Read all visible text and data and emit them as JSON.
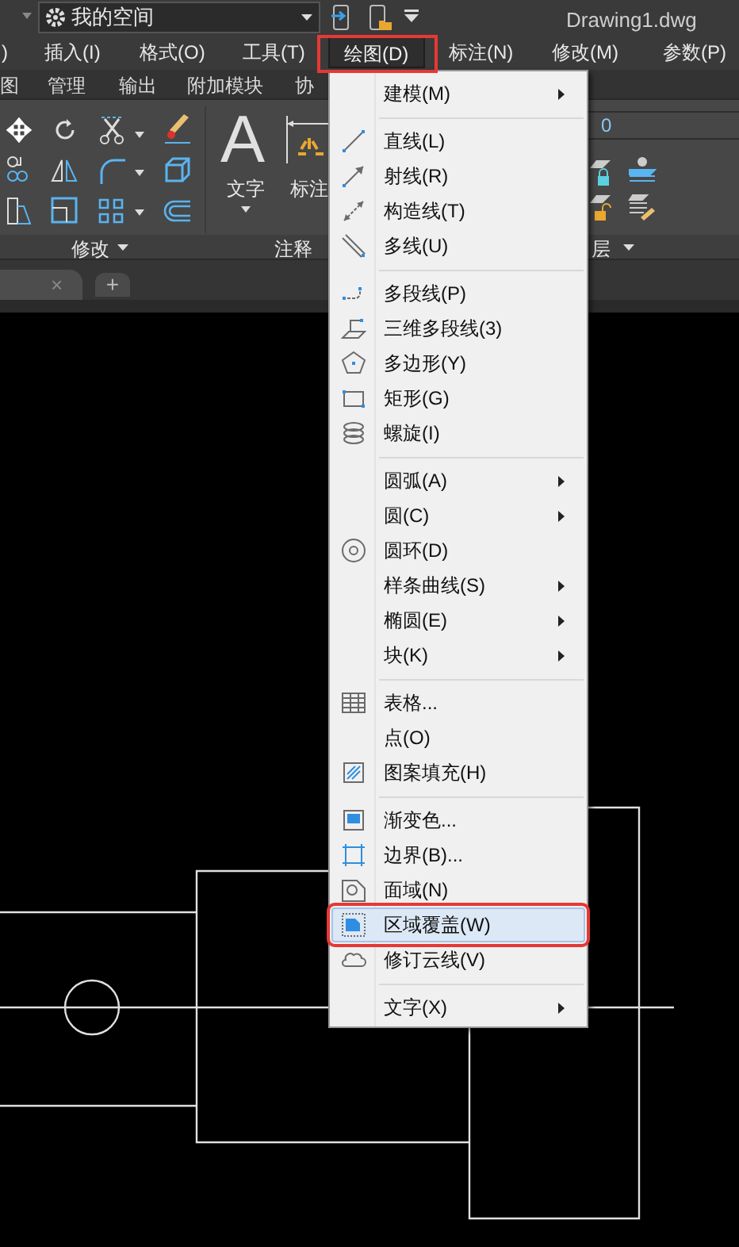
{
  "title_bar": {
    "workspace": "我的空间",
    "file_name": "Drawing1.dwg"
  },
  "menu_bar": [
    {
      "label": ")",
      "selected": false,
      "annotated": false
    },
    {
      "label": "插入(I)",
      "selected": false,
      "annotated": false
    },
    {
      "label": "格式(O)",
      "selected": false,
      "annotated": false
    },
    {
      "label": "工具(T)",
      "selected": false,
      "annotated": false
    },
    {
      "label": "绘图(D)",
      "selected": true,
      "annotated": true
    },
    {
      "label": "标注(N)",
      "selected": false,
      "annotated": false
    },
    {
      "label": "修改(M)",
      "selected": false,
      "annotated": false
    },
    {
      "label": "参数(P)",
      "selected": false,
      "annotated": false
    }
  ],
  "ribbon_tabs": [
    "图",
    "管理",
    "输出",
    "附加模块",
    "协"
  ],
  "ribbon": {
    "modify_title": "修改",
    "annotate_title": "注释",
    "text_glyph": "A",
    "text_label": "文字",
    "dimension_label": "标注",
    "layer_title": "层",
    "layer_value": "0"
  },
  "file_tabs": {
    "close_glyph": "×",
    "new_tab_glyph": "+"
  },
  "draw_menu": [
    {
      "kind": "item",
      "label": "建模(M)",
      "submenu": true,
      "selected": false,
      "annotated": false
    },
    {
      "kind": "separator"
    },
    {
      "kind": "item",
      "label": "直线(L)",
      "submenu": false,
      "selected": false,
      "annotated": false
    },
    {
      "kind": "item",
      "label": "射线(R)",
      "submenu": false,
      "selected": false,
      "annotated": false
    },
    {
      "kind": "item",
      "label": "构造线(T)",
      "submenu": false,
      "selected": false,
      "annotated": false
    },
    {
      "kind": "item",
      "label": "多线(U)",
      "submenu": false,
      "selected": false,
      "annotated": false
    },
    {
      "kind": "separator"
    },
    {
      "kind": "item",
      "label": "多段线(P)",
      "submenu": false,
      "selected": false,
      "annotated": false
    },
    {
      "kind": "item",
      "label": "三维多段线(3)",
      "submenu": false,
      "selected": false,
      "annotated": false
    },
    {
      "kind": "item",
      "label": "多边形(Y)",
      "submenu": false,
      "selected": false,
      "annotated": false
    },
    {
      "kind": "item",
      "label": "矩形(G)",
      "submenu": false,
      "selected": false,
      "annotated": false
    },
    {
      "kind": "item",
      "label": "螺旋(I)",
      "submenu": false,
      "selected": false,
      "annotated": false
    },
    {
      "kind": "separator"
    },
    {
      "kind": "item",
      "label": "圆弧(A)",
      "submenu": true,
      "selected": false,
      "annotated": false
    },
    {
      "kind": "item",
      "label": "圆(C)",
      "submenu": true,
      "selected": false,
      "annotated": false
    },
    {
      "kind": "item",
      "label": "圆环(D)",
      "submenu": false,
      "selected": false,
      "annotated": false
    },
    {
      "kind": "item",
      "label": "样条曲线(S)",
      "submenu": true,
      "selected": false,
      "annotated": false
    },
    {
      "kind": "item",
      "label": "椭圆(E)",
      "submenu": true,
      "selected": false,
      "annotated": false
    },
    {
      "kind": "item",
      "label": "块(K)",
      "submenu": true,
      "selected": false,
      "annotated": false
    },
    {
      "kind": "separator"
    },
    {
      "kind": "item",
      "label": "表格...",
      "submenu": false,
      "selected": false,
      "annotated": false
    },
    {
      "kind": "item",
      "label": "点(O)",
      "submenu": false,
      "selected": false,
      "annotated": false
    },
    {
      "kind": "item",
      "label": "图案填充(H)",
      "submenu": false,
      "selected": false,
      "annotated": false
    },
    {
      "kind": "separator"
    },
    {
      "kind": "item",
      "label": "渐变色...",
      "submenu": false,
      "selected": false,
      "annotated": false
    },
    {
      "kind": "item",
      "label": "边界(B)...",
      "submenu": false,
      "selected": false,
      "annotated": false
    },
    {
      "kind": "item",
      "label": "面域(N)",
      "submenu": false,
      "selected": false,
      "annotated": false
    },
    {
      "kind": "item",
      "label": "区域覆盖(W)",
      "submenu": false,
      "selected": true,
      "annotated": true
    },
    {
      "kind": "item",
      "label": "修订云线(V)",
      "submenu": false,
      "selected": false,
      "annotated": false
    },
    {
      "kind": "separator"
    },
    {
      "kind": "item",
      "label": "文字(X)",
      "submenu": true,
      "selected": false,
      "annotated": false
    }
  ]
}
